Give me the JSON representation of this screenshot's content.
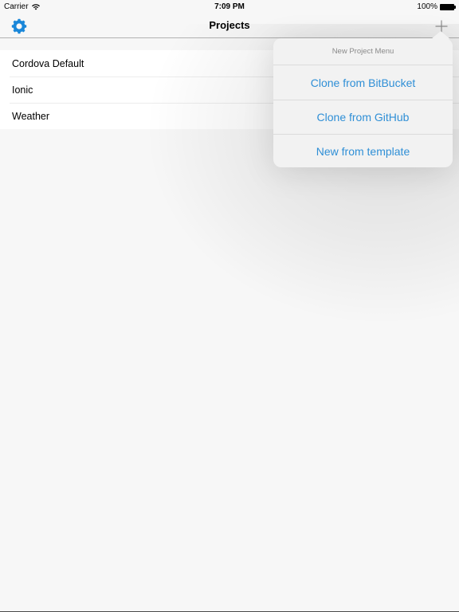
{
  "status_bar": {
    "carrier": "Carrier",
    "time": "7:09 PM",
    "battery": "100%"
  },
  "nav_bar": {
    "title": "Projects",
    "left_icon": "gear-icon",
    "right_icon": "plus-icon"
  },
  "projects": [
    {
      "name": "Cordova Default"
    },
    {
      "name": "Ionic"
    },
    {
      "name": "Weather"
    }
  ],
  "popover": {
    "title": "New Project Menu",
    "items": [
      {
        "label": "Clone from BitBucket"
      },
      {
        "label": "Clone from GitHub"
      },
      {
        "label": "New from template"
      }
    ]
  },
  "colors": {
    "accent": "#2f8fd6",
    "background": "#f7f7f7"
  }
}
